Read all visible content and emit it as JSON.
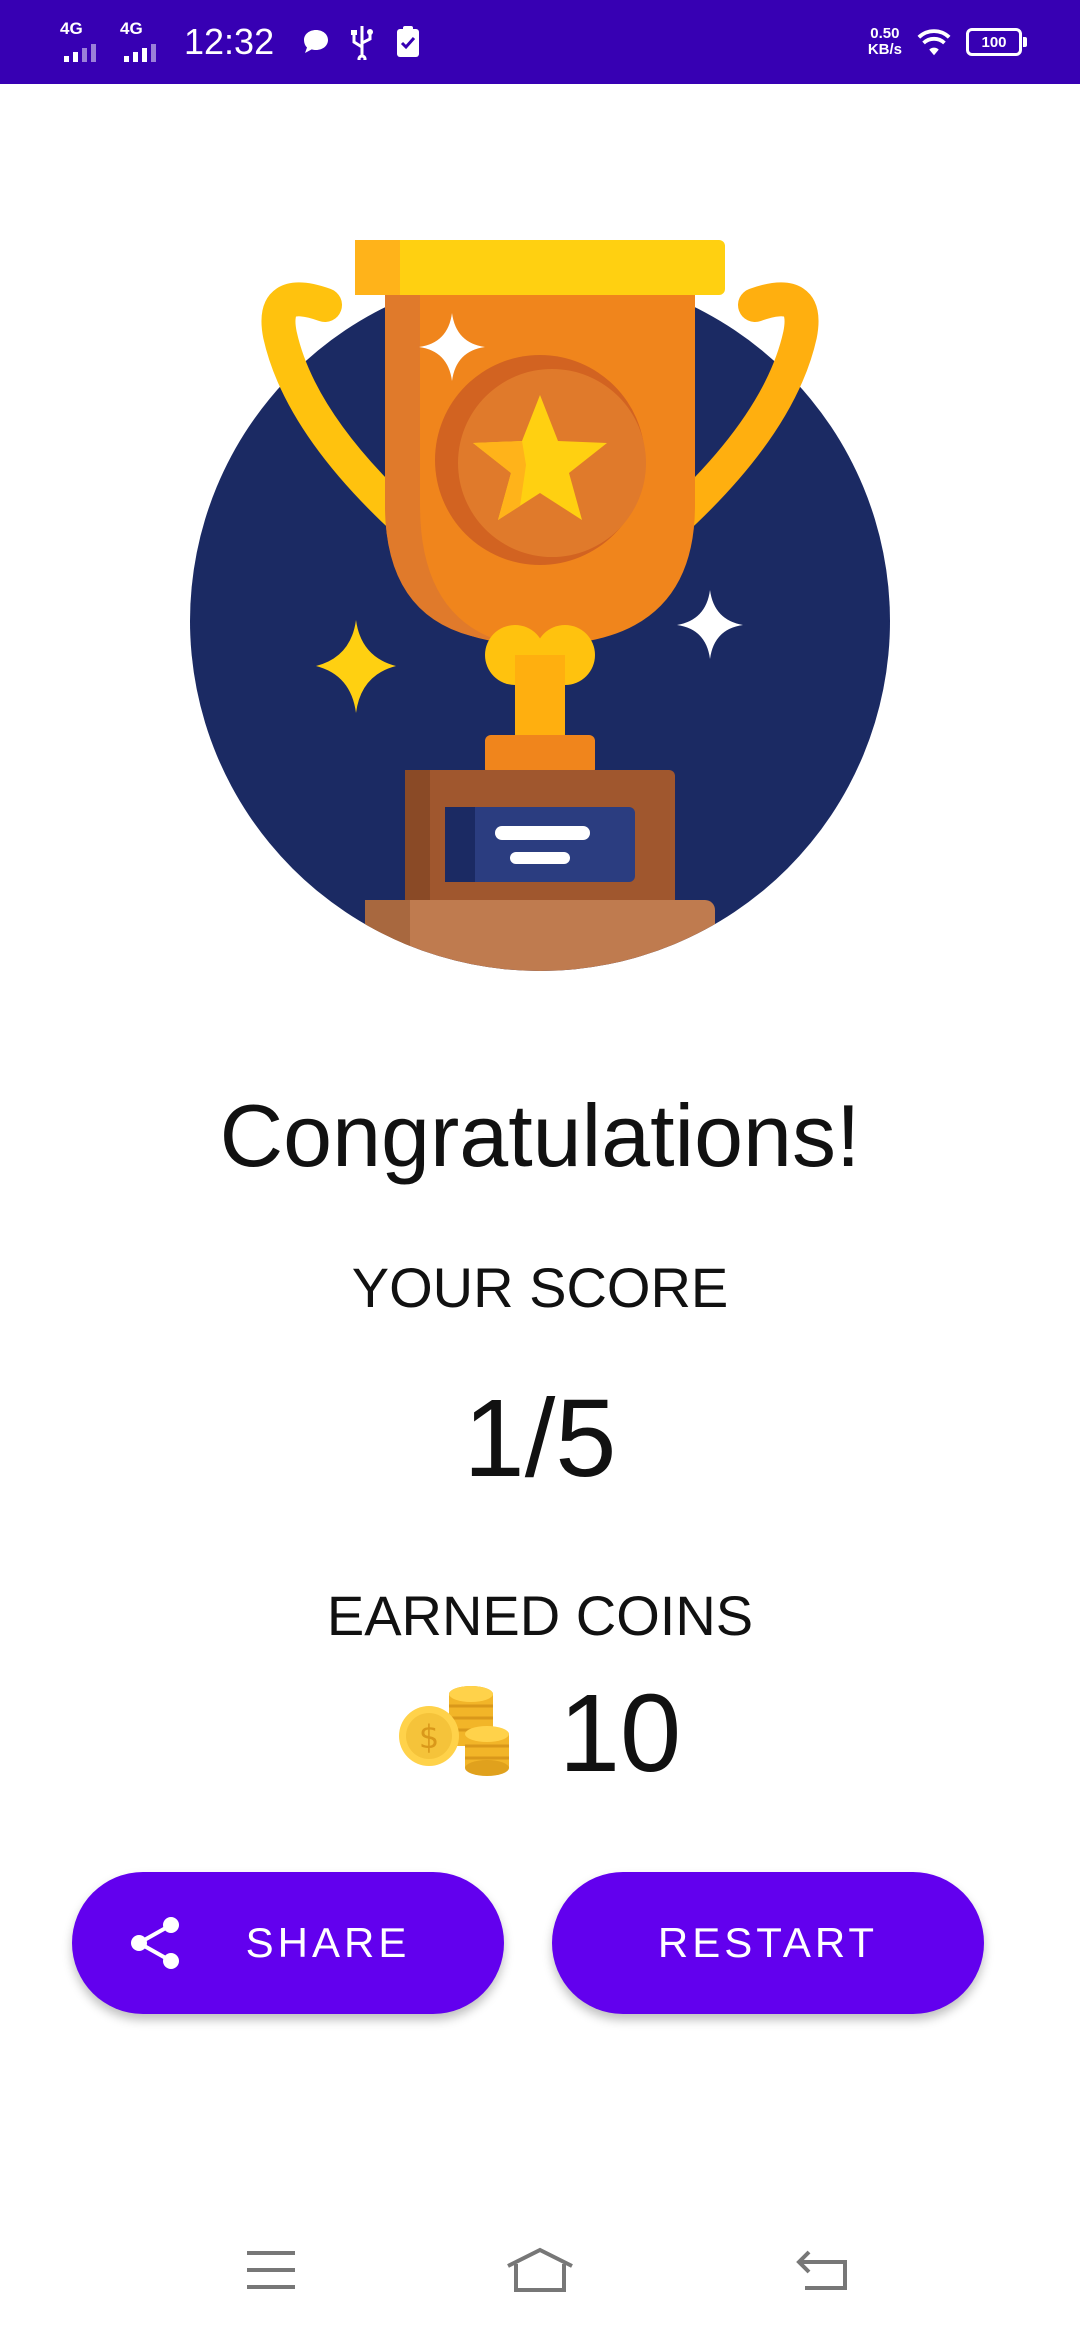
{
  "status_bar": {
    "network1": "4G",
    "network2": "4G",
    "time": "12:32",
    "speed_value": "0.50",
    "speed_unit": "KB/s",
    "battery": "100",
    "icons": [
      "signal-icon",
      "message-icon",
      "usb-icon",
      "clipboard-icon",
      "wifi-icon",
      "battery-icon"
    ]
  },
  "result": {
    "title": "Congratulations!",
    "score_label": "YOUR SCORE",
    "score_value": "1/5",
    "coins_label": "EARNED COINS",
    "coins_value": "10"
  },
  "actions": {
    "share_label": "SHARE",
    "restart_label": "RESTART"
  },
  "colors": {
    "status_bar": "#3700b3",
    "button": "#6200ee",
    "trophy_bg": "#1b2a63",
    "gold": "#ffd011",
    "orange": "#f0851c"
  },
  "nav": {
    "icons": [
      "menu-icon",
      "home-icon",
      "back-icon"
    ]
  }
}
